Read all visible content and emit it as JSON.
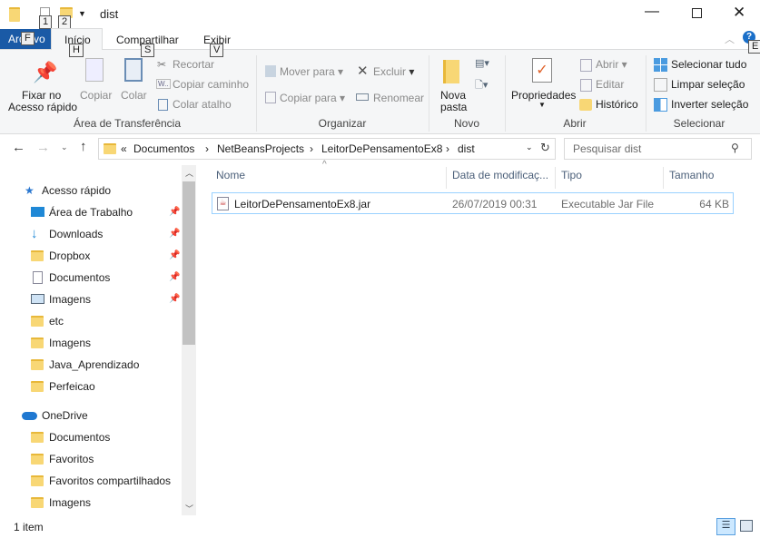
{
  "window": {
    "title": "dist",
    "quick_access_numbers": [
      "1",
      "2"
    ]
  },
  "tabs": [
    {
      "label": "Arquivo",
      "key": "F"
    },
    {
      "label": "Início",
      "key": "H"
    },
    {
      "label": "Compartilhar",
      "key": "S"
    },
    {
      "label": "Exibir",
      "key": "V"
    }
  ],
  "help_key": "E",
  "ribbon": {
    "clipboard": {
      "pin": "Fixar no",
      "pin2": "Acesso rápido",
      "copy": "Copiar",
      "paste": "Colar",
      "cut": "Recortar",
      "copy_path": "Copiar caminho",
      "paste_shortcut": "Colar atalho",
      "group": "Área de Transferência"
    },
    "organize": {
      "move": "Mover para",
      "copy_to": "Copiar para",
      "delete": "Excluir",
      "rename": "Renomear",
      "group": "Organizar"
    },
    "new": {
      "new_folder": "Nova",
      "new_folder2": "pasta",
      "group": "Novo"
    },
    "open": {
      "properties": "Propriedades",
      "open": "Abrir",
      "edit": "Editar",
      "history": "Histórico",
      "group": "Abrir"
    },
    "select": {
      "all": "Selecionar tudo",
      "none": "Limpar seleção",
      "invert": "Inverter seleção",
      "group": "Selecionar"
    }
  },
  "address": {
    "prefix": "«",
    "crumbs": [
      "Documentos",
      "NetBeansProjects",
      "LeitorDePensamentoEx8",
      "dist"
    ],
    "search_placeholder": "Pesquisar dist"
  },
  "nav": {
    "quick_access": "Acesso rápido",
    "quick_items": [
      {
        "label": "Área de Trabalho",
        "pinned": true
      },
      {
        "label": "Downloads",
        "pinned": true
      },
      {
        "label": "Dropbox",
        "pinned": true
      },
      {
        "label": "Documentos",
        "pinned": true
      },
      {
        "label": "Imagens",
        "pinned": true
      },
      {
        "label": "etc"
      },
      {
        "label": "Imagens"
      },
      {
        "label": "Java_Aprendizado"
      },
      {
        "label": "Perfeicao"
      }
    ],
    "onedrive": "OneDrive",
    "onedrive_items": [
      "Documentos",
      "Favoritos",
      "Favoritos compartilhados",
      "Imagens"
    ]
  },
  "columns": {
    "name": "Nome",
    "date": "Data de modificaç...",
    "type": "Tipo",
    "size": "Tamanho"
  },
  "files": [
    {
      "name": "LeitorDePensamentoEx8.jar",
      "date": "26/07/2019 00:31",
      "type": "Executable Jar File",
      "size": "64 KB"
    }
  ],
  "status": {
    "count": "1 item"
  },
  "colors": {
    "accent": "#1a5aa6",
    "selection": "#cce8ff"
  }
}
